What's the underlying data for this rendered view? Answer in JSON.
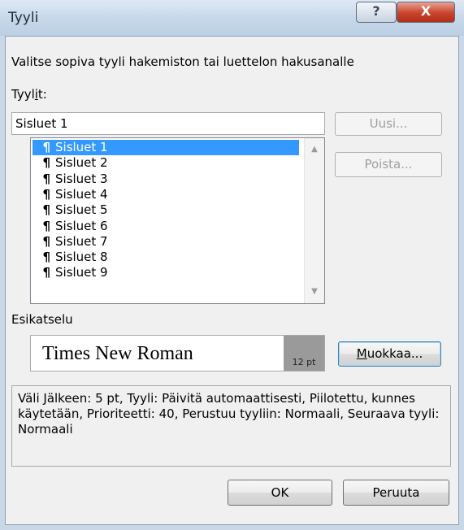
{
  "window": {
    "title": "Tyyli",
    "help_label": "?",
    "close_label": "X"
  },
  "instruction": "Valitse sopiva tyyli hakemiston tai luettelon hakusanalle",
  "styles_label": {
    "pre": "Tyyl",
    "accel": "i",
    "post": "t:"
  },
  "style_input_value": "Sisluet 1",
  "buttons": {
    "new": "Uusi...",
    "delete": "Poista...",
    "modify_accel": "M",
    "modify_rest": "uokkaa...",
    "ok": "OK",
    "cancel": "Peruuta"
  },
  "styles_list": {
    "selected_index": 0,
    "items": [
      {
        "icon": "pilcrow-icon",
        "glyph": "¶",
        "label": "Sisluet 1"
      },
      {
        "icon": "pilcrow-icon",
        "glyph": "¶",
        "label": "Sisluet 2"
      },
      {
        "icon": "pilcrow-icon",
        "glyph": "¶",
        "label": "Sisluet 3"
      },
      {
        "icon": "pilcrow-icon",
        "glyph": "¶",
        "label": "Sisluet 4"
      },
      {
        "icon": "pilcrow-icon",
        "glyph": "¶",
        "label": "Sisluet 5"
      },
      {
        "icon": "pilcrow-icon",
        "glyph": "¶",
        "label": "Sisluet 6"
      },
      {
        "icon": "pilcrow-icon",
        "glyph": "¶",
        "label": "Sisluet 7"
      },
      {
        "icon": "pilcrow-icon",
        "glyph": "¶",
        "label": "Sisluet 8"
      },
      {
        "icon": "pilcrow-icon",
        "glyph": "¶",
        "label": "Sisluet 9"
      }
    ]
  },
  "preview_label": "Esikatselu",
  "preview": {
    "font_name": "Times New Roman",
    "size": "12 pt"
  },
  "description": "Väli Jälkeen:  5 pt, Tyyli: Päivitä automaattisesti, Piilotettu, kunnes käytetään, Prioriteetti: 40, Perustuu tyyliin: Normaali, Seuraava tyyli: Normaali",
  "colors": {
    "selection": "#3399ff",
    "close_button": "#c7432b",
    "preview_size_bg": "#9a9a9a"
  }
}
